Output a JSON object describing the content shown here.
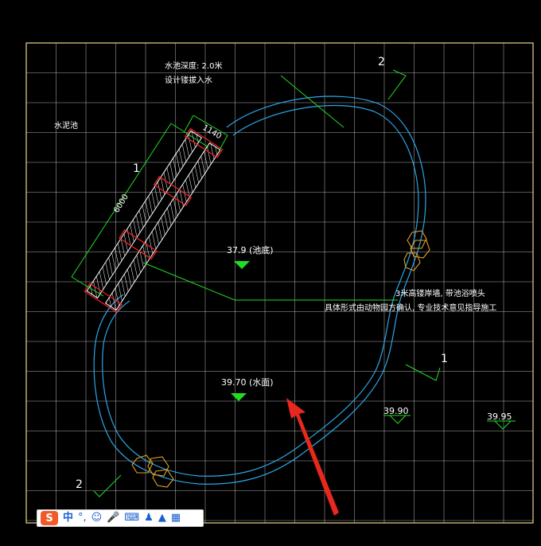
{
  "colors": {
    "background": "#000000",
    "grid": "#ffffff",
    "pool_outline": "#2aa6e6",
    "leader": "#22dd22",
    "rock": "#e8a020",
    "hatch": "#ffffff",
    "red": "#ff2020",
    "arrow": "#e8281e"
  },
  "notes": {
    "pool_depth_line1": "水池深度: 2.0米",
    "pool_depth_line2": "设计镂拔入水",
    "left_label": "水泥池",
    "fountain_line1": "3米高镂岸墙, 带池浴喷头",
    "fountain_line2": "具体形式由动物园方确认, 专业技术意见指导施工"
  },
  "dimensions": {
    "width": "1140",
    "length": "6000"
  },
  "section_marks": {
    "top": "2",
    "left_section": "1",
    "right_section": "1",
    "bottom": "2"
  },
  "elevations": {
    "pool_bottom": "37.9 (池底)",
    "water_surface": "39.70 (水面)",
    "right_a": "39.90",
    "right_b": "39.95"
  },
  "ime_toolbar": {
    "logo": "S",
    "mode": "中",
    "punct": "°,",
    "icons": [
      "emoji-icon",
      "microphone-icon",
      "keyboard-icon",
      "user-icon",
      "shirt-icon",
      "grid-icon"
    ]
  }
}
